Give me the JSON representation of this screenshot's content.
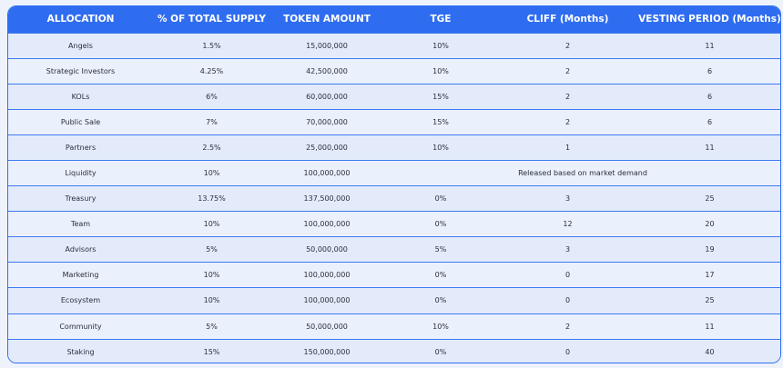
{
  "table": {
    "headers": [
      "ALLOCATION",
      "% OF TOTAL SUPPLY",
      "TOKEN AMOUNT",
      "TGE",
      "CLIFF (Months)",
      "VESTING PERIOD (Months)"
    ],
    "rows": [
      [
        "Angels",
        "1.5%",
        "15,000,000",
        "10%",
        "2",
        "11"
      ],
      [
        "Strategic Investors",
        "4.25%",
        "42,500,000",
        "10%",
        "2",
        "6"
      ],
      [
        "KOLs",
        "6%",
        "60,000,000",
        "15%",
        "2",
        "6"
      ],
      [
        "Public Sale",
        "7%",
        "70,000,000",
        "15%",
        "2",
        "6"
      ],
      [
        "Partners",
        "2.5%",
        "25,000,000",
        "10%",
        "1",
        "11"
      ],
      [
        "Liquidity",
        "10%",
        "100,000,000",
        "Released based on market demand"
      ],
      [
        "Treasury",
        "13.75%",
        "137,500,000",
        "0%",
        "3",
        "25"
      ],
      [
        "Team",
        "10%",
        "100,000,000",
        "0%",
        "12",
        "20"
      ],
      [
        "Advisors",
        "5%",
        "50,000,000",
        "5%",
        "3",
        "19"
      ],
      [
        "Marketing",
        "10%",
        "100,000,000",
        "0%",
        "0",
        "17"
      ],
      [
        "Ecosystem",
        "10%",
        "100,000,000",
        "0%",
        "0",
        "25"
      ],
      [
        "Community",
        "5%",
        "50,000,000",
        "10%",
        "2",
        "11"
      ],
      [
        "Staking",
        "15%",
        "150,000,000",
        "0%",
        "0",
        "40"
      ]
    ]
  },
  "colors": {
    "header_bg": "#2f6df0",
    "header_text": "#ffffff",
    "row_bg": "#e3ebfb",
    "border": "#3d7af2"
  }
}
